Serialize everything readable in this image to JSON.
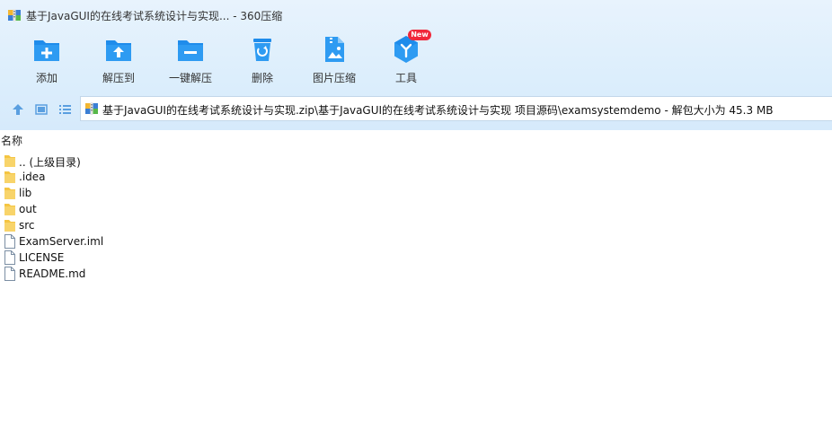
{
  "window": {
    "title": "基于JavaGUI的在线考试系统设计与实现... - 360压缩"
  },
  "toolbar": {
    "items": [
      {
        "label": "添加",
        "icon": "add-folder-icon"
      },
      {
        "label": "解压到",
        "icon": "extract-to-icon"
      },
      {
        "label": "一键解压",
        "icon": "one-click-extract-icon"
      },
      {
        "label": "删除",
        "icon": "delete-bin-icon"
      },
      {
        "label": "图片压缩",
        "icon": "image-compress-icon"
      },
      {
        "label": "工具",
        "icon": "tools-icon"
      }
    ],
    "new_badge": "New"
  },
  "nav": {
    "path": "基于JavaGUI的在线考试系统设计与实现.zip\\基于JavaGUI的在线考试系统设计与实现 项目源码\\examsystemdemo - 解包大小为 45.3 MB"
  },
  "list": {
    "header": "名称",
    "items": [
      {
        "name": ".. (上级目录)",
        "type": "folder"
      },
      {
        "name": ".idea",
        "type": "folder"
      },
      {
        "name": "lib",
        "type": "folder"
      },
      {
        "name": "out",
        "type": "folder"
      },
      {
        "name": "src",
        "type": "folder"
      },
      {
        "name": "ExamServer.iml",
        "type": "file"
      },
      {
        "name": "LICENSE",
        "type": "file"
      },
      {
        "name": "README.md",
        "type": "file"
      }
    ]
  },
  "colors": {
    "accent": "#2a8fe6",
    "folder": "#f5c542",
    "badge": "#f0283a"
  }
}
